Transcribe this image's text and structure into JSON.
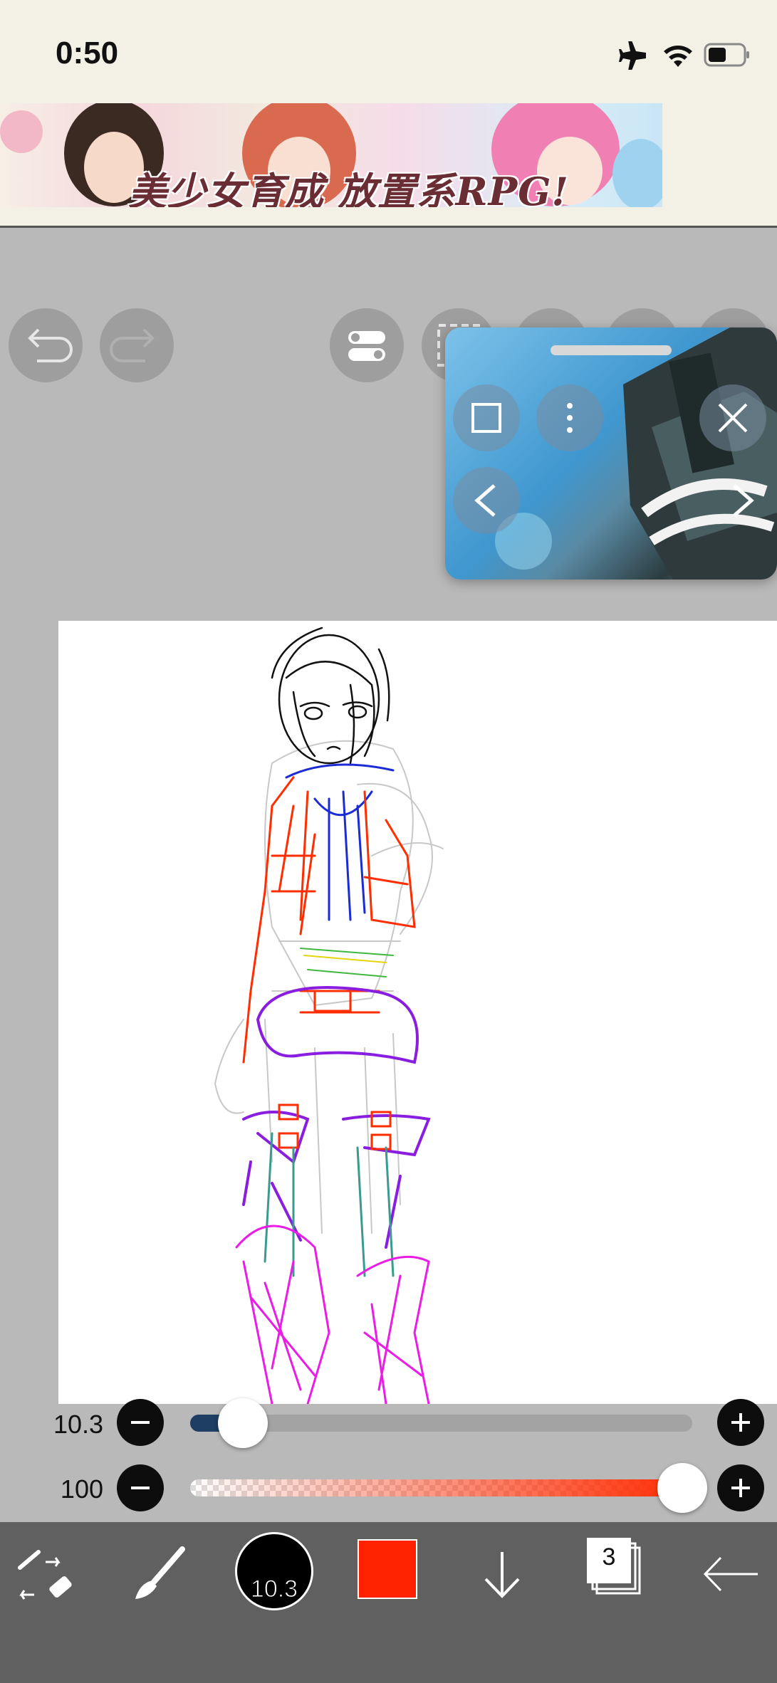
{
  "status_bar": {
    "time": "0:50",
    "icons": [
      "airplane-icon",
      "wifi-icon",
      "battery-icon"
    ]
  },
  "ad": {
    "text": "美少女育成 放置系RPG!"
  },
  "toolbar_top": {
    "buttons": [
      "undo-icon",
      "redo-icon",
      "toggle-icon",
      "selection-icon"
    ]
  },
  "pip": {
    "buttons": [
      "expand-icon",
      "more-icon",
      "close-icon",
      "previous-icon",
      "next-icon"
    ]
  },
  "brush_size": {
    "value": "10.3",
    "fraction": 0.105
  },
  "opacity": {
    "value": "100",
    "fraction": 0.98,
    "color": "#ff2a00"
  },
  "bottom_toolbar": {
    "brush_size_label": "10.3",
    "current_color": "#ff2200",
    "layer_count": "3",
    "items": [
      "transform-eraser-icon",
      "brush-icon",
      "brush-size-indicator",
      "color-swatch",
      "download-icon",
      "layers-icon",
      "back-arrow-icon"
    ]
  },
  "colors": {
    "background": "#b9b9b9",
    "toolbar": "#606060",
    "slider_fill": "#1f3e63"
  }
}
